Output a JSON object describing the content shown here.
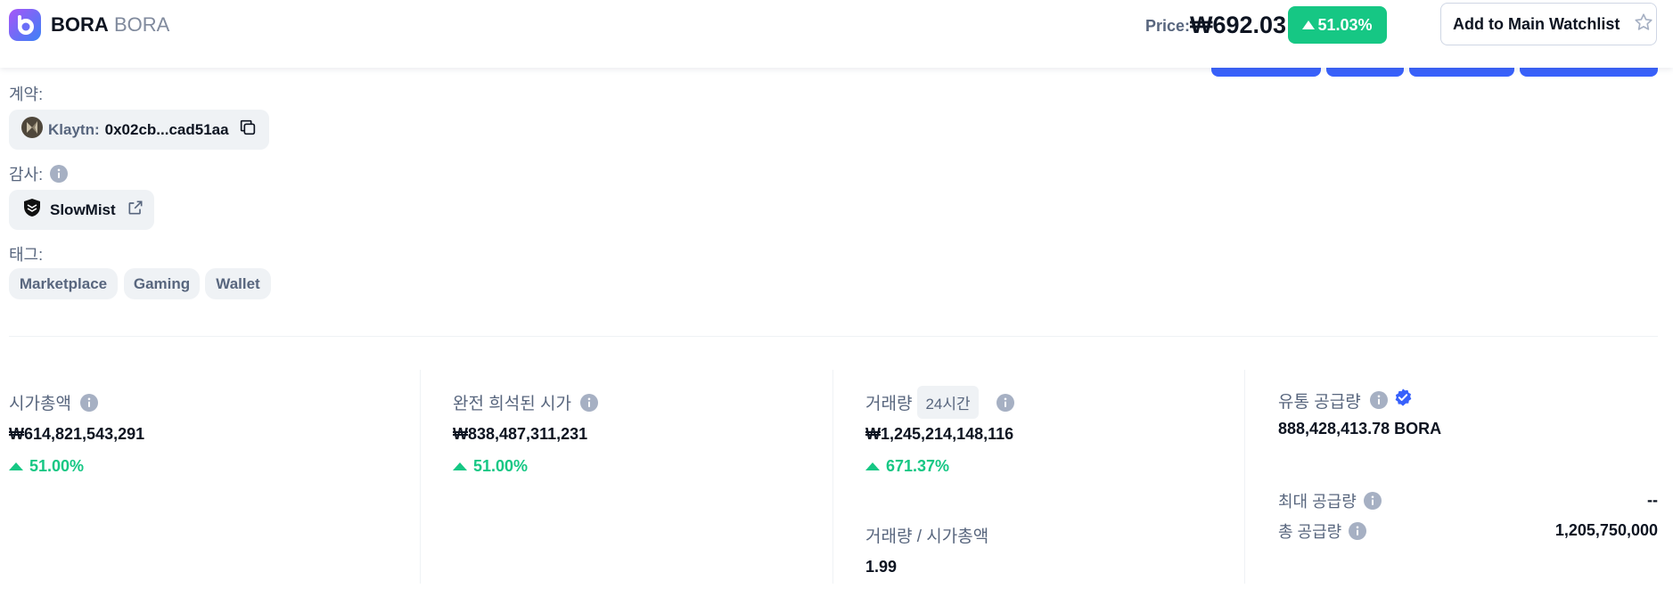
{
  "header": {
    "coin_name": "BORA",
    "coin_symbol": "BORA",
    "price_label": "Price:",
    "price_value": "₩692.03",
    "price_change": "51.03%",
    "watchlist_button": "Add to Main Watchlist"
  },
  "contract": {
    "label": "계약:",
    "network": "Klaytn:",
    "address": "0x02cb...cad51aa"
  },
  "audit": {
    "label": "감사:",
    "auditor": "SlowMist"
  },
  "tags": {
    "label": "태그:",
    "items": [
      "Marketplace",
      "Gaming",
      "Wallet"
    ]
  },
  "stats": {
    "market_cap": {
      "label": "시가총액",
      "value": "₩614,821,543,291",
      "change": "51.00%"
    },
    "fdv": {
      "label": "완전 희석된 시가",
      "value": "₩838,487,311,231",
      "change": "51.00%"
    },
    "volume": {
      "label": "거래량",
      "timeframe": "24시간",
      "value": "₩1,245,214,148,116",
      "change": "671.37%"
    },
    "vol_mcap": {
      "label": "거래량 / 시가총액",
      "value": "1.99"
    },
    "circulating": {
      "label": "유통 공급량",
      "value": "888,428,413.78 BORA"
    },
    "max_supply": {
      "label": "최대 공급량",
      "value": "--"
    },
    "total_supply": {
      "label": "총 공급량",
      "value": "1,205,750,000"
    }
  },
  "colors": {
    "positive": "#16c784",
    "accent_blue": "#3861fb",
    "muted_text": "#58667e",
    "chip_bg": "#eff2f5"
  }
}
